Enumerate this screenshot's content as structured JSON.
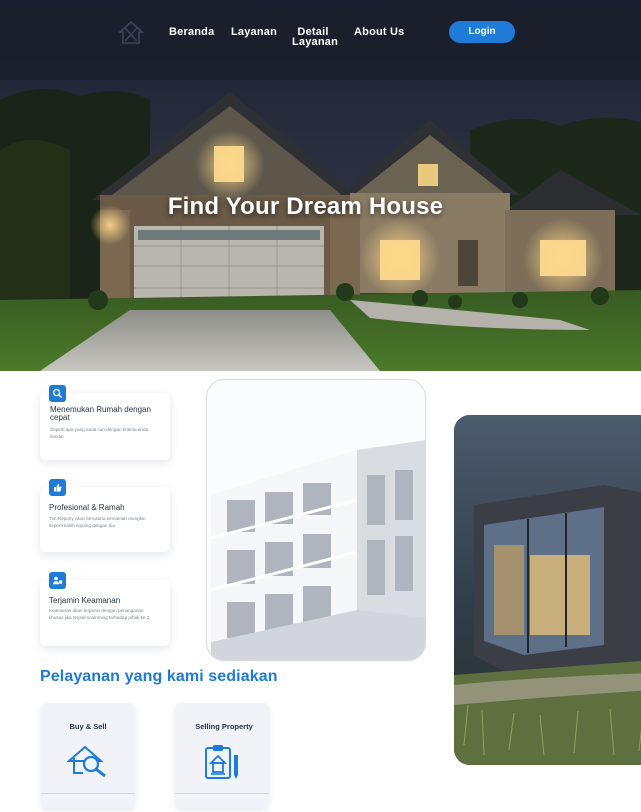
{
  "nav": {
    "logo_icon": "house-logo-icon",
    "links": [
      {
        "label": "Beranda"
      },
      {
        "label": "Layanan"
      },
      {
        "label": "Detail\nLayanan"
      },
      {
        "label": "About Us"
      }
    ],
    "login_label": "Login"
  },
  "hero": {
    "title": "Find Your Dream House"
  },
  "features": [
    {
      "icon": "search-icon",
      "title": "Menemukan Rumah dengan cepat",
      "desc": "Seperti apa yang anda cari dengan kriteria anda sendiri"
    },
    {
      "icon": "thumbs-up-icon",
      "title": "Profesional & Ramah",
      "desc": "Tim Reporty akan berusaha semamah mungkin seperti kasih sayang dengan dia"
    },
    {
      "icon": "security-user-icon",
      "title": "Terjamin Keamanan",
      "desc": "Keamanan akan terjamin dengan penanganan khusus jika terjadi scamming terhadap pihak ke 3"
    }
  ],
  "services_section": {
    "title": "Pelayanan yang kami sediakan",
    "cards": [
      {
        "label": "Buy & Sell",
        "icon": "house-search-icon"
      },
      {
        "label": "Selling Property",
        "icon": "property-document-icon"
      }
    ]
  },
  "colors": {
    "accent": "#1e7bd8",
    "heading": "#263445",
    "card_bg": "#f2f3f8"
  }
}
